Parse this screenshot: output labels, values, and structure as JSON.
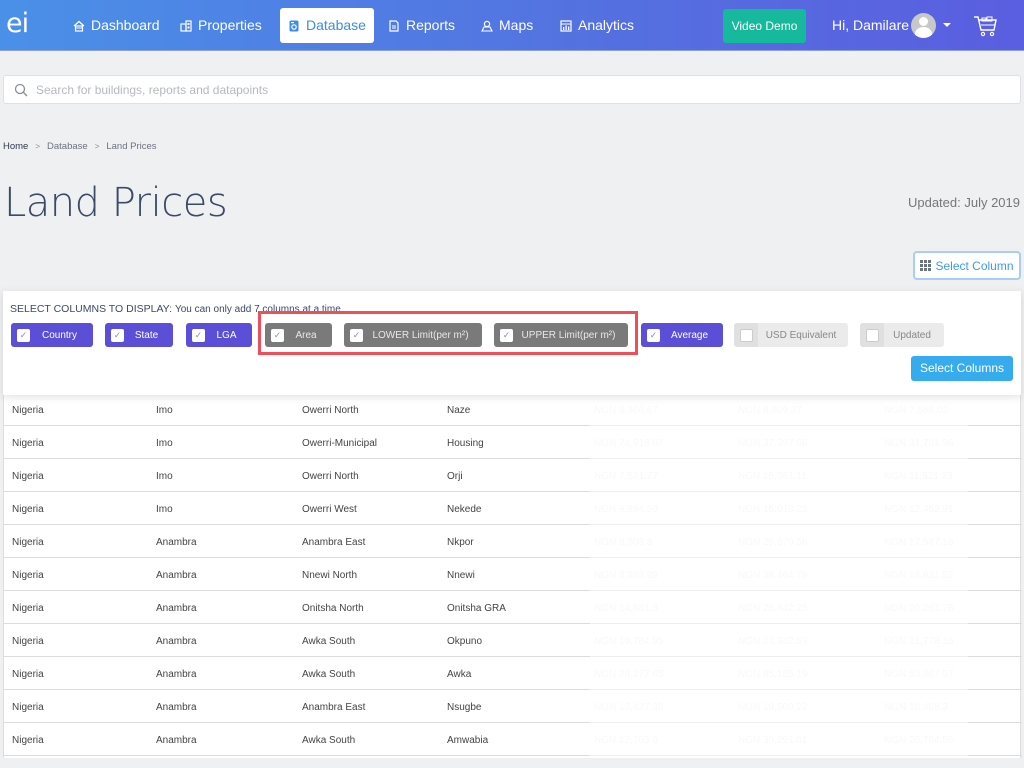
{
  "navbar": {
    "logo": "ei",
    "items": [
      {
        "label": "Dashboard",
        "icon": "home-icon",
        "active": false
      },
      {
        "label": "Properties",
        "icon": "building-icon",
        "active": false
      },
      {
        "label": "Database",
        "icon": "database-icon",
        "active": true
      },
      {
        "label": "Reports",
        "icon": "document-icon",
        "active": false
      },
      {
        "label": "Maps",
        "icon": "map-pin-icon",
        "active": false
      },
      {
        "label": "Analytics",
        "icon": "chart-icon",
        "active": false
      }
    ],
    "video_demo_label": "Video Demo",
    "greeting": "Hi, Damilare",
    "colors": {
      "accent": "#5470e0",
      "video_demo": "#16b99b"
    }
  },
  "search": {
    "placeholder": "Search for buildings, reports and datapoints",
    "value": ""
  },
  "breadcrumb": {
    "items": [
      "Home",
      "Database",
      "Land Prices"
    ],
    "separator": ">"
  },
  "page": {
    "title": "Land Prices",
    "updated": "Updated: July 2019",
    "select_column_label": "Select Column"
  },
  "column_selector": {
    "heading": "SELECT COLUMNS TO DISPLAY:",
    "hint": "You can only add 7 columns at a time",
    "columns": [
      {
        "label": "Country",
        "checked": true,
        "highlighted": false
      },
      {
        "label": "State",
        "checked": true,
        "highlighted": false
      },
      {
        "label": "LGA",
        "checked": true,
        "highlighted": false
      },
      {
        "label": "Area",
        "checked": true,
        "highlighted": true
      },
      {
        "label": "LOWER Limit(per m²)",
        "checked": true,
        "highlighted": true
      },
      {
        "label": "UPPER Limit(per m²)",
        "checked": true,
        "highlighted": true
      },
      {
        "label": "Average",
        "checked": true,
        "highlighted": false
      },
      {
        "label": "USD Equivalent",
        "checked": false,
        "highlighted": false
      },
      {
        "label": "Updated",
        "checked": false,
        "highlighted": false
      }
    ],
    "submit_label": "Select Columns",
    "colors": {
      "checked": "#5b4fd8",
      "highlighted": "#7a7a7a",
      "highlight_border": "#ef4f58",
      "submit": "#36acef"
    }
  },
  "table": {
    "rows": [
      [
        "Nigeria",
        "Imo",
        "Owerri North",
        "Naze",
        "NGN 6,366.67",
        "NGN 8,809.37",
        "NGN 7,588.02"
      ],
      [
        "Nigeria",
        "Imo",
        "Owerri-Municipal",
        "Housing",
        "NGN 24,918.67",
        "NGN 37,397.66",
        "NGN 31,701.96"
      ],
      [
        "Nigeria",
        "Imo",
        "Owerri North",
        "Orji",
        "NGN 7,521.77",
        "NGN 15,361.11",
        "NGN 11,521.23"
      ],
      [
        "Nigeria",
        "Imo",
        "Owerri West",
        "Nekede",
        "NGN 9,894.59",
        "NGN 15,013.23",
        "NGN 12,453.91"
      ],
      [
        "Nigeria",
        "Anambra",
        "Anambra East",
        "Nkpor",
        "NGN 8,503.8",
        "NGN 26,670.56",
        "NGN 17,587.18"
      ],
      [
        "Nigeria",
        "Anambra",
        "Nnewi North",
        "Nnewi",
        "NGN 6,983.99",
        "NGN 38,464.79",
        "NGN 18,621.52"
      ],
      [
        "Nigeria",
        "Anambra",
        "Onitsha North",
        "Onitsha GRA",
        "NGN 14,881.3",
        "NGN 25,642.25",
        "NGN 20,261.78"
      ],
      [
        "Nigeria",
        "Anambra",
        "Awka South",
        "Okpuno",
        "NGN 19,784.95",
        "NGN 24,342.89",
        "NGN 21,778.16"
      ],
      [
        "Nigeria",
        "Anambra",
        "Awka South",
        "Awka",
        "NGN 28,277.65",
        "NGN 85,185.19",
        "NGN 53,667.97"
      ],
      [
        "Nigeria",
        "Anambra",
        "Anambra East",
        "Nsugbe",
        "NGN 13,427.38",
        "NGN 19,509.22",
        "NGN 16,468.3"
      ],
      [
        "Nigeria",
        "Anambra",
        "Awka South",
        "Amwabia",
        "NGN 12,703.6",
        "NGN 30,291.01",
        "NGN 20,764.56"
      ]
    ]
  }
}
